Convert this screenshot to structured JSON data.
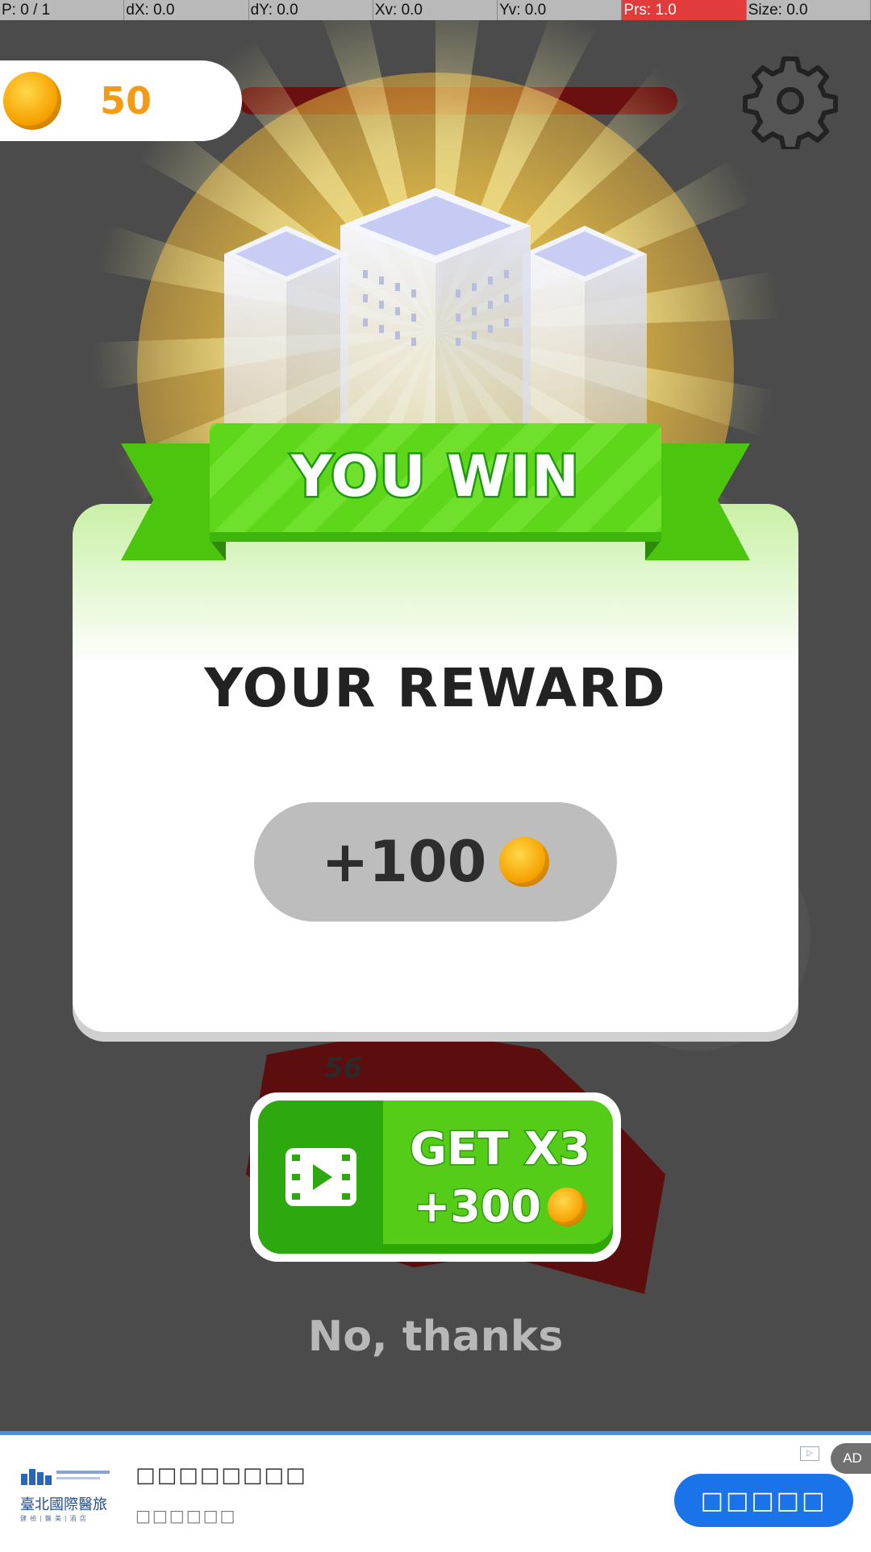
{
  "debug": {
    "cells": [
      {
        "label": "P: 0 / 1"
      },
      {
        "label": "dX: 0.0"
      },
      {
        "label": "dY: 0.0"
      },
      {
        "label": "Xv: 0.0"
      },
      {
        "label": "Yv: 0.0"
      },
      {
        "label": "Prs: 1.0"
      },
      {
        "label": "Size: 0.0"
      }
    ]
  },
  "hud": {
    "coins": "50"
  },
  "background": {
    "region_number": "56"
  },
  "dialog": {
    "banner": "YOU WIN",
    "reward_title": "YOUR REWARD",
    "reward_amount": "+100"
  },
  "multiplier_button": {
    "title": "GET X3",
    "amount": "+300"
  },
  "decline_label": "No, thanks",
  "ad": {
    "logo_text": "臺北國際醫旅",
    "logo_sub": "健 檢 | 醫 美 | 酒 店",
    "headline": "□□□□□□□□",
    "subline": "□□□□□□",
    "cta": "□□□□□",
    "badge": "AD"
  },
  "colors": {
    "coin": "#f6a100",
    "ribbon_green": "#5ed61a",
    "button_green": "#55cc18",
    "ad_blue": "#1a73e8",
    "hot_cell": "#e23b3b"
  },
  "icons": [
    "coin-icon",
    "gear-icon",
    "video-play-icon",
    "buildings-illustration"
  ]
}
